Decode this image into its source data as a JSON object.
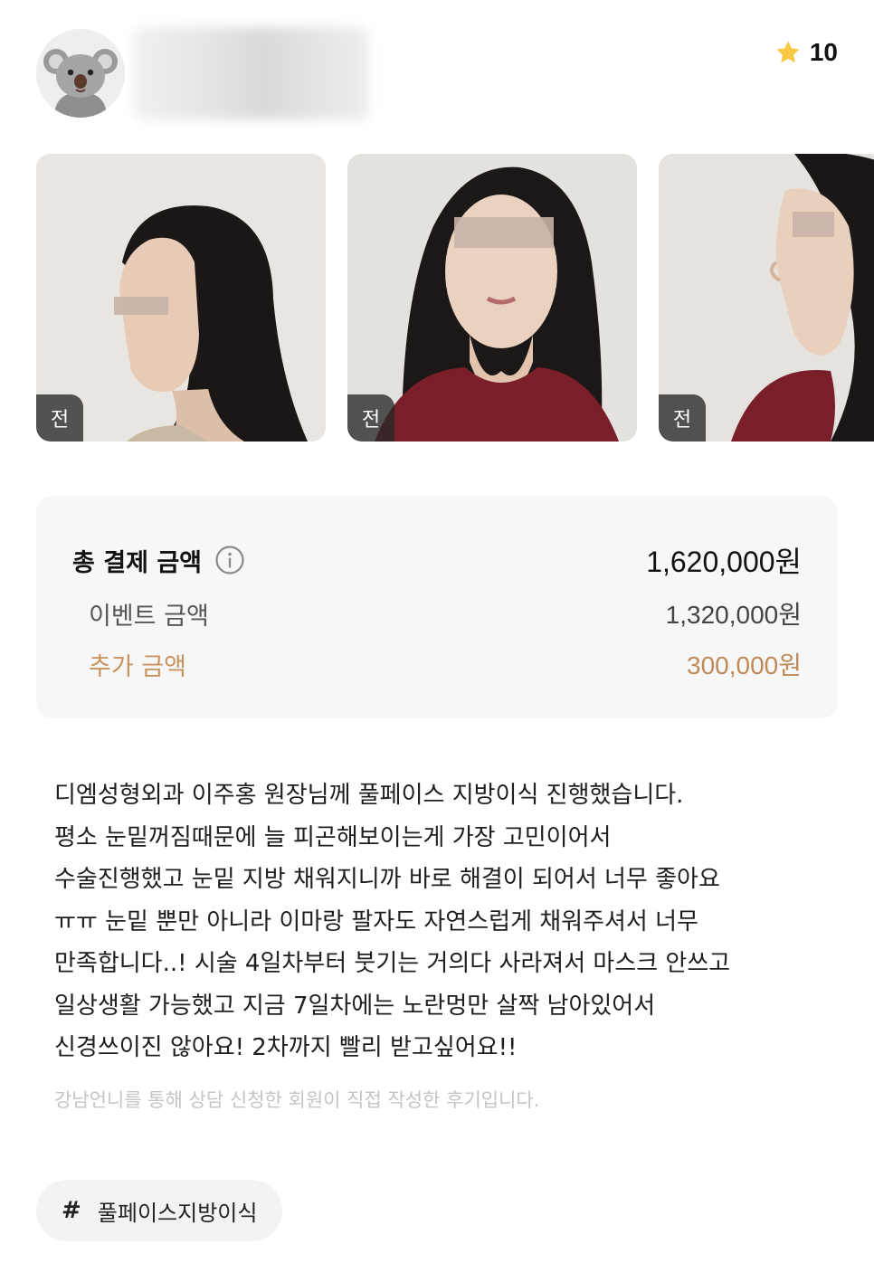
{
  "header": {
    "rating_score": "10",
    "star_color": "#f7c844"
  },
  "photos": [
    {
      "tag": "전",
      "icon": "photo-profile-left"
    },
    {
      "tag": "전",
      "icon": "photo-front"
    },
    {
      "tag": "전",
      "icon": "photo-profile-right"
    }
  ],
  "price": {
    "total_label": "총 결제 금액",
    "total_value": "1,620,000원",
    "event_label": "이벤트 금액",
    "event_value": "1,320,000원",
    "extra_label": "추가 금액",
    "extra_value": "300,000원",
    "accent_color": "#c08a58"
  },
  "review": {
    "lines": [
      "디엠성형외과 이주홍 원장님께 풀페이스 지방이식 진행했습니다.",
      "평소 눈밑꺼짐때문에 늘 피곤해보이는게 가장 고민이어서",
      "수술진행했고 눈밑 지방 채워지니까 바로 해결이 되어서 너무 좋아요",
      "ㅠㅠ 눈밑 뿐만 아니라 이마랑 팔자도 자연스럽게 채워주셔서 너무",
      "만족합니다..! 시술 4일차부터 붓기는 거의다 사라져서 마스크 안쓰고",
      "일상생활 가능했고 지금 7일차에는 노란멍만 살짝 남아있어서",
      "신경쓰이진 않아요! 2차까지 빨리 받고싶어요!!"
    ],
    "disclaimer": "강남언니를 통해 상담 신청한 회원이 직접 작성한 후기입니다."
  },
  "hashtag": {
    "symbol": "#",
    "label": "풀페이스지방이식"
  }
}
